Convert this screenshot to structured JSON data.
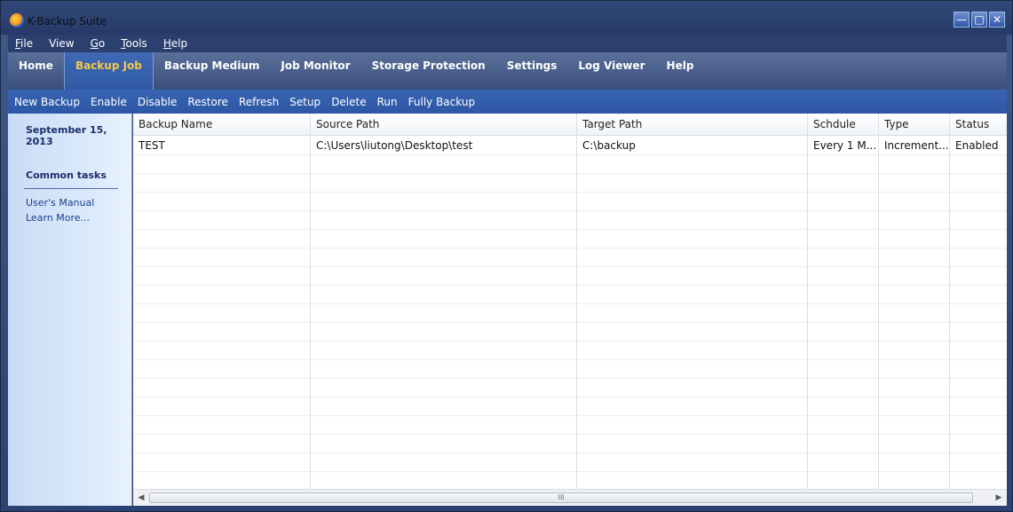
{
  "window": {
    "title": "K-Backup Suite"
  },
  "menu": [
    {
      "label": "File",
      "accel": "F",
      "rest": "ile"
    },
    {
      "label": "View",
      "accel": "",
      "rest": "View"
    },
    {
      "label": "Go",
      "accel": "G",
      "rest": "o"
    },
    {
      "label": "Tools",
      "accel": "T",
      "rest": "ools"
    },
    {
      "label": "Help",
      "accel": "H",
      "rest": "elp"
    }
  ],
  "tabs": [
    {
      "label": "Home",
      "active": false
    },
    {
      "label": "Backup Job",
      "active": true
    },
    {
      "label": "Backup Medium",
      "active": false
    },
    {
      "label": "Job Monitor",
      "active": false
    },
    {
      "label": "Storage Protection",
      "active": false
    },
    {
      "label": "Settings",
      "active": false
    },
    {
      "label": "Log Viewer",
      "active": false
    },
    {
      "label": "Help",
      "active": false
    }
  ],
  "toolbar": [
    "New Backup",
    "Enable",
    "Disable",
    "Restore",
    "Refresh",
    "Setup",
    "Delete",
    "Run",
    "Fully Backup"
  ],
  "sidebar": {
    "date": "September 15, 2013",
    "heading": "Common tasks",
    "links": [
      "User's Manual",
      "Learn More..."
    ]
  },
  "table": {
    "columns": [
      "Backup Name",
      "Source Path",
      "Target Path",
      "Schdule",
      "Type",
      "Status"
    ],
    "rows": [
      [
        "TEST",
        "C:\\Users\\liutong\\Desktop\\test",
        "C:\\backup",
        "Every 1 M...",
        "Increment...",
        "Enabled"
      ]
    ]
  },
  "scrollbar": {
    "left_arrow": "◀",
    "right_arrow": "▶",
    "grip": "III"
  },
  "colors": {
    "accent_tab_text": "#f5c84a",
    "toolbar_bg": "#3863b2",
    "sidebar_text": "#1a2f6b"
  }
}
